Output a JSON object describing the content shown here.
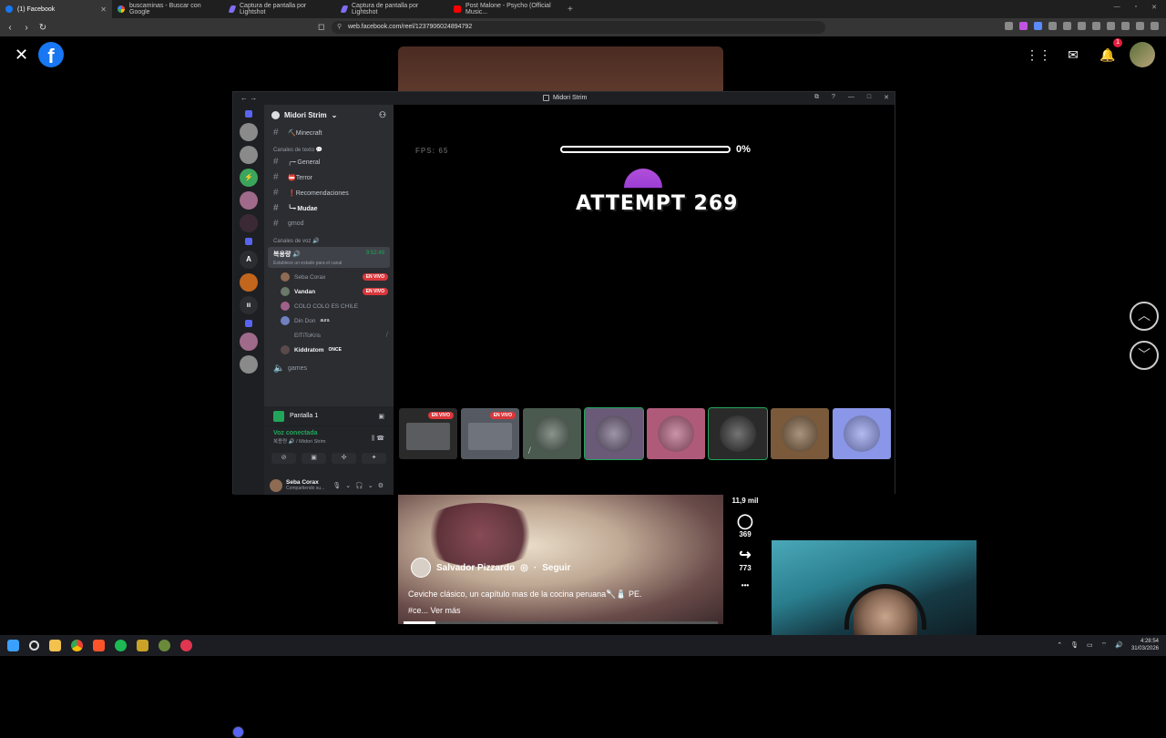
{
  "browser": {
    "tabs": [
      {
        "label": "(1) Facebook",
        "icon": "facebook-icon",
        "active": true
      },
      {
        "label": "buscaminas - Buscar con Google",
        "icon": "google-icon"
      },
      {
        "label": "Captura de pantalla por Lightshot",
        "icon": "lightshot-icon"
      },
      {
        "label": "Captura de pantalla por Lightshot",
        "icon": "lightshot-icon"
      },
      {
        "label": "Post Malone - Psycho (Official Music...",
        "icon": "youtube-icon"
      }
    ],
    "new_tab": "+",
    "url": "web.facebook.com/reel/1237906024894792"
  },
  "facebook": {
    "close": "✕",
    "logo": "f",
    "notif_count": "1",
    "reel": {
      "author": "Salvador Pizzardo",
      "verified": "◎",
      "follow": "Seguir",
      "caption": "Ceviche clásico, un capítulo mas de la cocina peruana🥄🧂 PE.",
      "caption_more_prefix": "#ce...",
      "caption_more": "Ver más",
      "progress": 0.1
    },
    "actions": {
      "likes": "11,9 mil",
      "comments": "369",
      "shares": "773",
      "more": "•••"
    }
  },
  "discord": {
    "window_title": "Midori Strim",
    "server_name": "Midori Strim",
    "channels_top": [
      {
        "name": "⛏️Minecraft",
        "style": "bright"
      }
    ],
    "text_category": "Canales de texto 💬",
    "text_channels": [
      {
        "name": "╭╼ General",
        "style": "bright"
      },
      {
        "name": "📛Terror",
        "style": "bright"
      },
      {
        "name": "❗Recomendaciones",
        "style": "bright"
      },
      {
        "name": "╰╼ Mudae",
        "style": "unread"
      },
      {
        "name": "gmod",
        "style": ""
      }
    ],
    "voice_category": "Canales de voz 🔊",
    "voice_channel": {
      "name": "복용량 🔊",
      "time": "9:52:49",
      "status_hint": "Establece un estado para el canal"
    },
    "voice_users": [
      {
        "name": "Seba Corax",
        "live": true,
        "bold": false
      },
      {
        "name": "Vandan",
        "live": true,
        "bold": true
      },
      {
        "name": "COLO COLO ES CHILE",
        "live": false,
        "bold": false
      },
      {
        "name": "Din Don",
        "tag": "aura",
        "live": false,
        "bold": false
      },
      {
        "name": "ElTiToKris",
        "live": false,
        "bold": false
      },
      {
        "name": "Kiddratom",
        "tag": "ONCE",
        "live": false,
        "bold": true
      }
    ],
    "games_channel": "games",
    "live_label": "EN VIVO",
    "screen_share": "Pantalla 1",
    "voice_connected": "Voz conectada",
    "voice_connected_sub": "복용량 🔊 / Midori Strim",
    "user": {
      "name": "Seba Corax",
      "status": "Compartiendo su..."
    }
  },
  "game": {
    "fps": "FPS: 65",
    "progress_pct": "0%",
    "progress": 0,
    "attempt": "ATTEMPT 269"
  },
  "tiles": [
    {
      "kind": "stream",
      "live": true,
      "color": "#2a2a2a"
    },
    {
      "kind": "stream",
      "live": true,
      "color": "#555a62"
    },
    {
      "kind": "avatar",
      "muted": true,
      "color": "#4a5a4e"
    },
    {
      "kind": "avatar",
      "color": "#6a5a78",
      "selected": true
    },
    {
      "kind": "avatar",
      "color": "#b05a7a"
    },
    {
      "kind": "avatar",
      "color": "#2a2a2a",
      "selected": true
    },
    {
      "kind": "avatar",
      "color": "#7a5a3a"
    },
    {
      "kind": "avatar",
      "color": "#8a96e8"
    }
  ],
  "taskbar": {
    "time": "4:28:54",
    "date": "31/03/2026"
  }
}
